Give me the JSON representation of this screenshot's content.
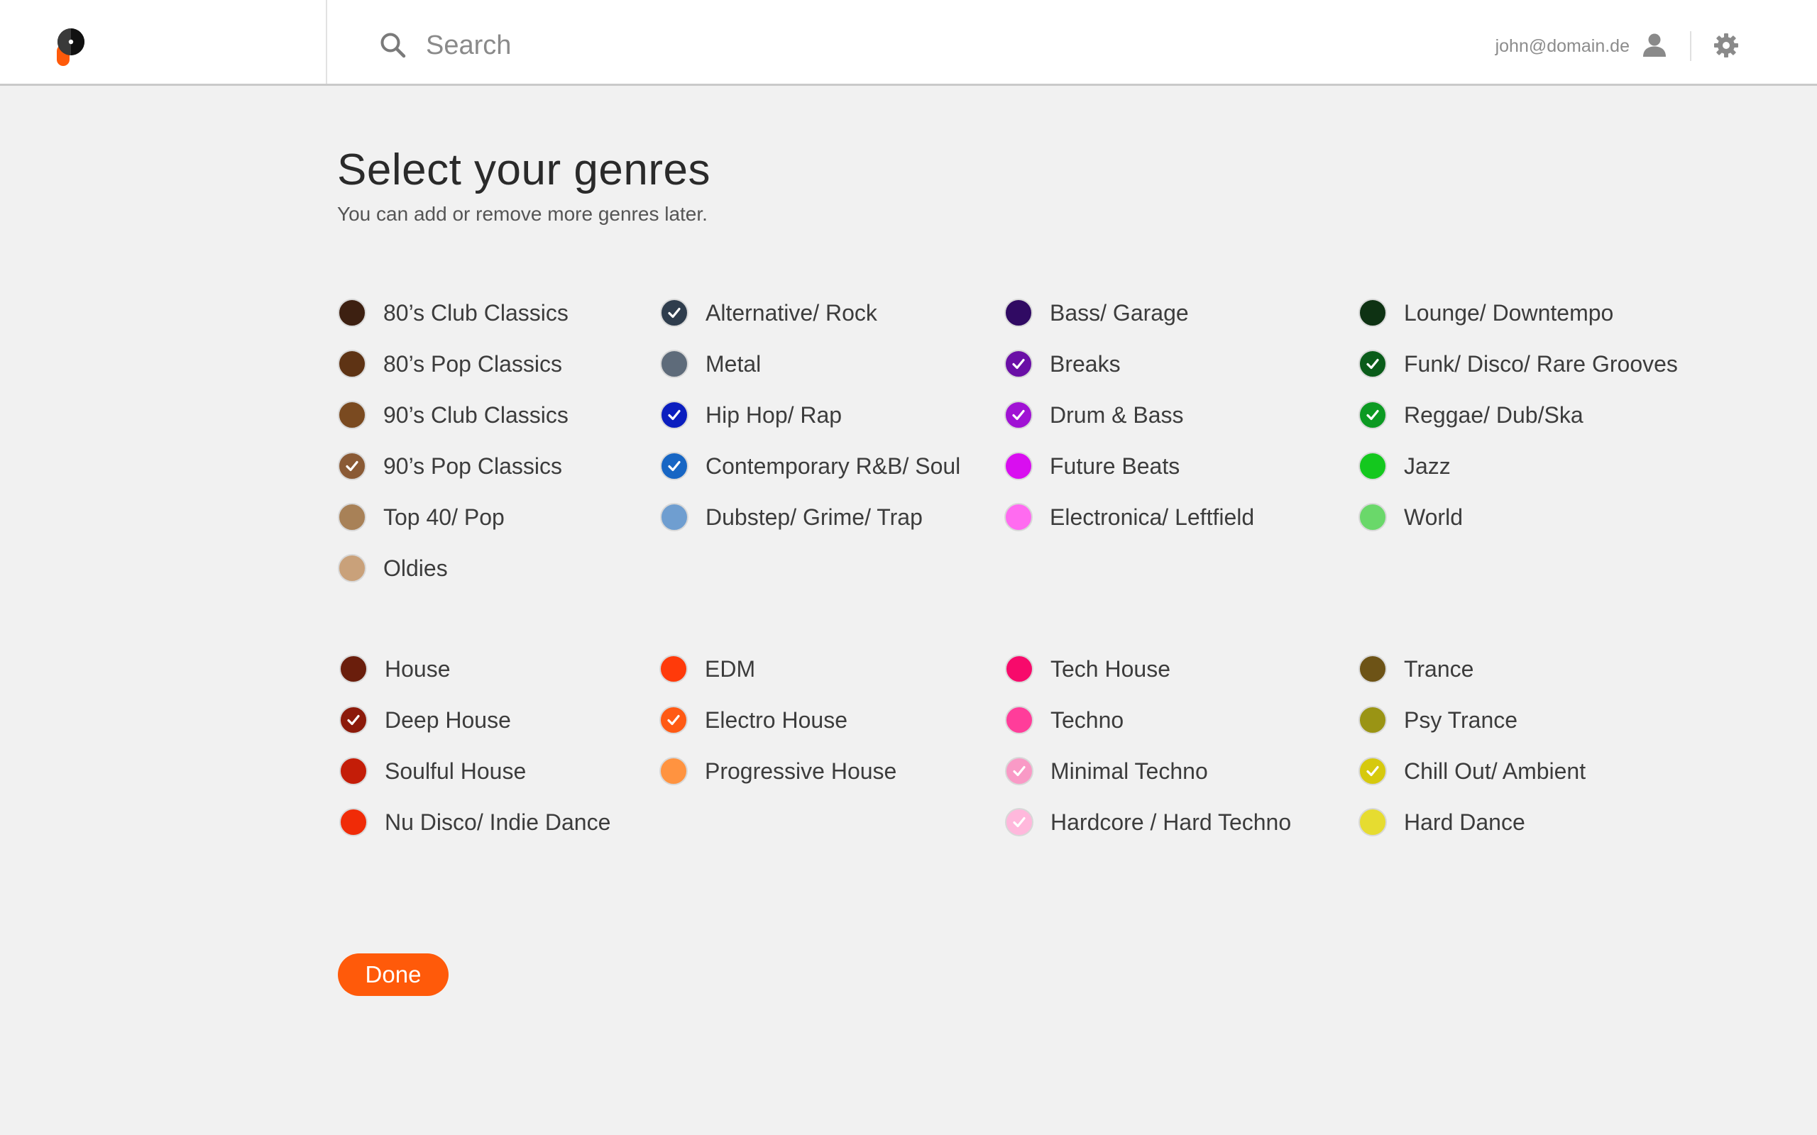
{
  "header": {
    "search_placeholder": "Search",
    "user_email": "john@domain.de",
    "brand_colors": {
      "dark": "#1f1f1f",
      "accent": "#ff5a0a"
    }
  },
  "title": "Select your genres",
  "subtitle": "You can add or remove more genres later.",
  "groups": [
    {
      "columns": [
        [
          {
            "label": "80’s Club Classics",
            "color": "#3d2011",
            "checked": false
          },
          {
            "label": "80’s Pop Classics",
            "color": "#5e3314",
            "checked": false
          },
          {
            "label": "90’s Club Classics",
            "color": "#7a4a20",
            "checked": false
          },
          {
            "label": "90’s Pop Classics",
            "color": "#8a5a35",
            "checked": true
          },
          {
            "label": "Top 40/ Pop",
            "color": "#a88157",
            "checked": false
          },
          {
            "label": "Oldies",
            "color": "#c9a17a",
            "checked": false
          }
        ],
        [
          {
            "label": "Alternative/ Rock",
            "color": "#2f3d4d",
            "checked": true
          },
          {
            "label": "Metal",
            "color": "#5e6b7a",
            "checked": false
          },
          {
            "label": "Hip Hop/ Rap",
            "color": "#0b1ebf",
            "checked": true
          },
          {
            "label": "Contemporary R&B/ Soul",
            "color": "#1766c4",
            "checked": true
          },
          {
            "label": "Dubstep/ Grime/ Trap",
            "color": "#6f9ed0",
            "checked": false
          }
        ],
        [
          {
            "label": "Bass/ Garage",
            "color": "#300a63",
            "checked": false
          },
          {
            "label": "Breaks",
            "color": "#6a0fa6",
            "checked": true
          },
          {
            "label": "Drum & Bass",
            "color": "#a012d4",
            "checked": true
          },
          {
            "label": "Future Beats",
            "color": "#d90ef0",
            "checked": false
          },
          {
            "label": "Electronica/ Leftfield",
            "color": "#ff6bf0",
            "checked": false
          }
        ],
        [
          {
            "label": "Lounge/ Downtempo",
            "color": "#0e3213",
            "checked": false
          },
          {
            "label": "Funk/ Disco/ Rare Grooves",
            "color": "#0a5c1a",
            "checked": true
          },
          {
            "label": "Reggae/ Dub/Ska",
            "color": "#0c9a22",
            "checked": true
          },
          {
            "label": "Jazz",
            "color": "#14c81e",
            "checked": false
          },
          {
            "label": "World",
            "color": "#6ad86a",
            "checked": false
          }
        ]
      ]
    },
    {
      "columns": [
        [
          {
            "label": "House",
            "color": "#6a1e0c",
            "checked": false
          },
          {
            "label": "Deep House",
            "color": "#8c1a0a",
            "checked": true
          },
          {
            "label": "Soulful House",
            "color": "#c41d08",
            "checked": false
          },
          {
            "label": "Nu Disco/ Indie Dance",
            "color": "#f02b07",
            "checked": false
          }
        ],
        [
          {
            "label": "EDM",
            "color": "#ff3a0a",
            "checked": false
          },
          {
            "label": "Electro House",
            "color": "#ff5a14",
            "checked": true
          },
          {
            "label": "Progressive House",
            "color": "#ff9340",
            "checked": false
          }
        ],
        [
          {
            "label": "Tech House",
            "color": "#f70a6b",
            "checked": false
          },
          {
            "label": "Techno",
            "color": "#ff3d9a",
            "checked": false
          },
          {
            "label": "Minimal Techno",
            "color": "#f99ac6",
            "checked": true
          },
          {
            "label": "Hardcore / Hard Techno",
            "color": "#ffb8dc",
            "checked": true
          }
        ],
        [
          {
            "label": "Trance",
            "color": "#6d5316",
            "checked": false
          },
          {
            "label": "Psy Trance",
            "color": "#9a9414",
            "checked": false
          },
          {
            "label": "Chill Out/ Ambient",
            "color": "#d6c90e",
            "checked": true
          },
          {
            "label": "Hard Dance",
            "color": "#e6dc30",
            "checked": false
          }
        ]
      ]
    }
  ],
  "done_label": "Done"
}
